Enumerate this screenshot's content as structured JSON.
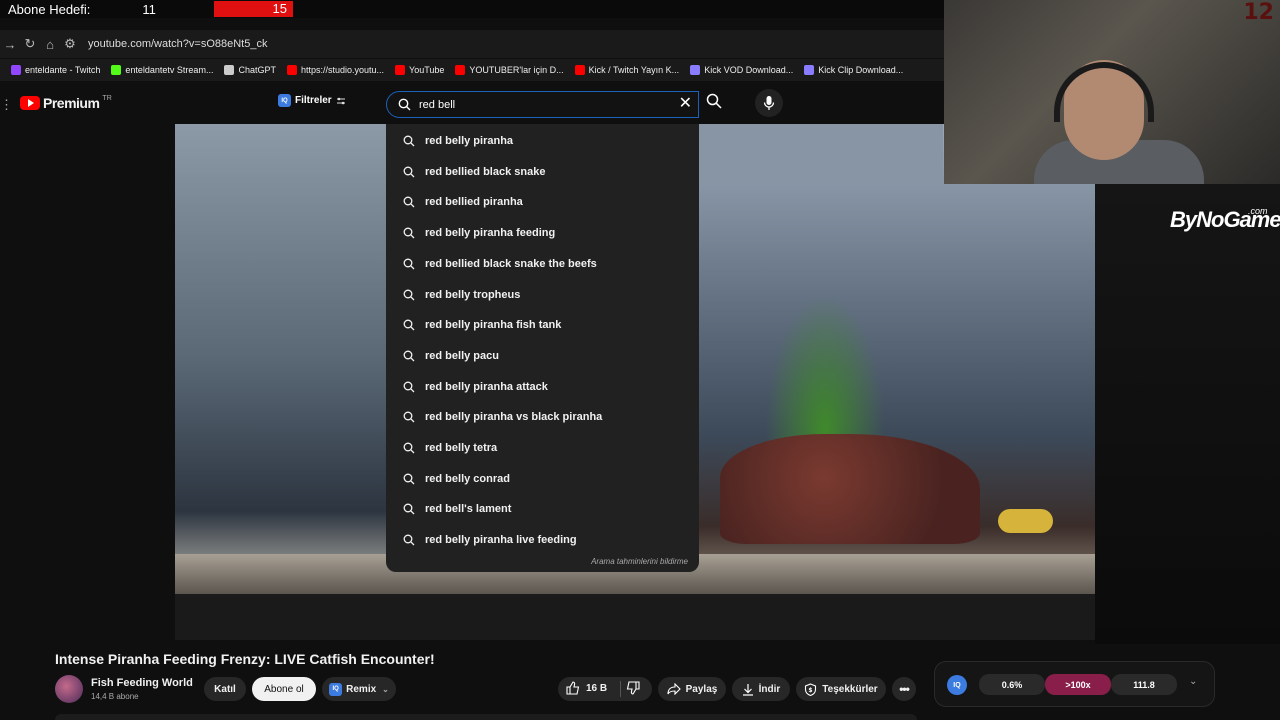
{
  "overlay": {
    "subscriber_goal_label": "Abone Hedefi:",
    "subscriber_count": "11",
    "subscriber_target": "15",
    "goal_progress": 0.733,
    "webcam_counter": "12",
    "sponsor_logo": "ByNoGame",
    "sponsor_logo_suffix": ".com"
  },
  "browser": {
    "url": "youtube.com/watch?v=sO88eNt5_ck",
    "bookmarks": [
      {
        "label": "enteldante - Twitch",
        "color": "#9146ff"
      },
      {
        "label": "enteldantetv Stream...",
        "color": "#53fc18"
      },
      {
        "label": "ChatGPT",
        "color": "#cccccc"
      },
      {
        "label": "https://studio.youtu...",
        "color": "#ff0000"
      },
      {
        "label": "YouTube",
        "color": "#ff0000"
      },
      {
        "label": "YOUTUBER'lar için D...",
        "color": "#ff0000"
      },
      {
        "label": "Kick / Twitch Yayın K...",
        "color": "#ff0000"
      },
      {
        "label": "Kick VOD Download...",
        "color": "#8a7cff"
      },
      {
        "label": "Kick Clip Download...",
        "color": "#8a7cff"
      }
    ]
  },
  "header": {
    "logo_text": "Premium",
    "region": "TR",
    "filters_label": "Filtreler",
    "iq_label": "IQ",
    "search_value": "red bell"
  },
  "suggestions": [
    "red belly piranha",
    "red bellied black snake",
    "red bellied piranha",
    "red belly piranha feeding",
    "red bellied black snake the beefs",
    "red belly tropheus",
    "red belly piranha fish tank",
    "red belly pacu",
    "red belly piranha attack",
    "red belly piranha vs black piranha",
    "red belly tetra",
    "red belly conrad",
    "red bell's lament",
    "red belly piranha live feeding"
  ],
  "dropdown_footer": "Arama tahminlerini bildirme",
  "video": {
    "title": "Intense Piranha Feeding Frenzy: LIVE Catfish Encounter!",
    "channel": "Fish Feeding World",
    "subscribers": "14,4 B abone",
    "join_label": "Katıl",
    "subscribe_label": "Abone ol",
    "remix_label": "Remix",
    "likes": "16 B",
    "share_label": "Paylaş",
    "download_label": "İndir",
    "thanks_label": "Teşekkürler"
  },
  "stats_widget": {
    "iq_label": "IQ",
    "stat1": "0.6%",
    "stat2": ">100x",
    "stat3": "111.8"
  }
}
